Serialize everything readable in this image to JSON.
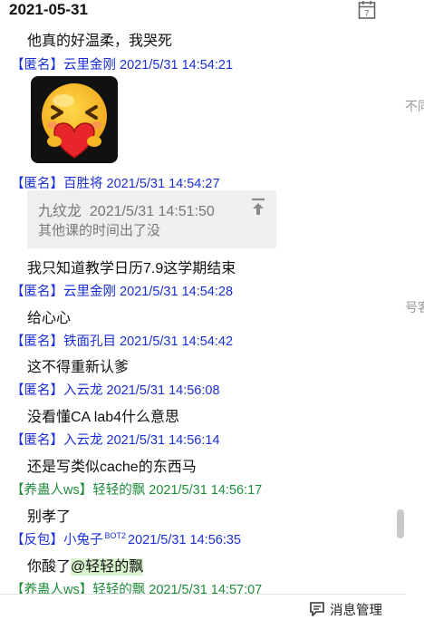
{
  "date_header": "2021-05-31",
  "calendar_icon_day": "7",
  "messages": [
    {
      "text": "他真的好温柔，我哭死"
    },
    {
      "tag": "【匿名】",
      "name": "云里金刚",
      "time": "2021/5/31 14:54:21",
      "color": "#1a2fd6"
    },
    {
      "tag": "【匿名】",
      "name": "百胜将",
      "time": "2021/5/31 14:54:27",
      "color": "#1a2fd6"
    },
    {
      "text": "我只知道教学日历7.9这学期结束"
    },
    {
      "tag": "【匿名】",
      "name": "云里金刚",
      "time": "2021/5/31 14:54:28",
      "color": "#1a2fd6"
    },
    {
      "text": "给心心"
    },
    {
      "tag": "【匿名】",
      "name": "铁面孔目",
      "time": "2021/5/31 14:54:42",
      "color": "#1a2fd6"
    },
    {
      "text": "这不得重新认爹"
    },
    {
      "tag": "【匿名】",
      "name": "入云龙",
      "time": "2021/5/31 14:56:08",
      "color": "#1a2fd6"
    },
    {
      "text": "没看懂CA lab4什么意思"
    },
    {
      "tag": "【匿名】",
      "name": "入云龙",
      "time": "2021/5/31 14:56:14",
      "color": "#1a2fd6"
    },
    {
      "text": "还是写类似cache的东西马"
    },
    {
      "tag": "【养蛊人ws】",
      "name": "轻轻的飘",
      "time": "2021/5/31 14:56:17",
      "color": "#1e8c3a"
    },
    {
      "text": "别孝了"
    },
    {
      "tag": "【反包】",
      "name": "小兔子",
      "badge": "BOT2",
      "time": "2021/5/31 14:56:35",
      "color": "#1a2fd6"
    },
    {
      "text": "你酸了",
      "mention": "@轻轻的飘"
    },
    {
      "tag": "【养蛊人ws】",
      "name": "轻轻的飘",
      "time": "2021/5/31 14:57:07",
      "color": "#1e8c3a"
    }
  ],
  "quote": {
    "name": "九纹龙",
    "time": "2021/5/31 14:51:50",
    "text": "其他课的时间出了没"
  },
  "edge_fragments": [
    "不同",
    "号客"
  ],
  "bottom_bar": {
    "message_manage_label": "消息管理"
  }
}
